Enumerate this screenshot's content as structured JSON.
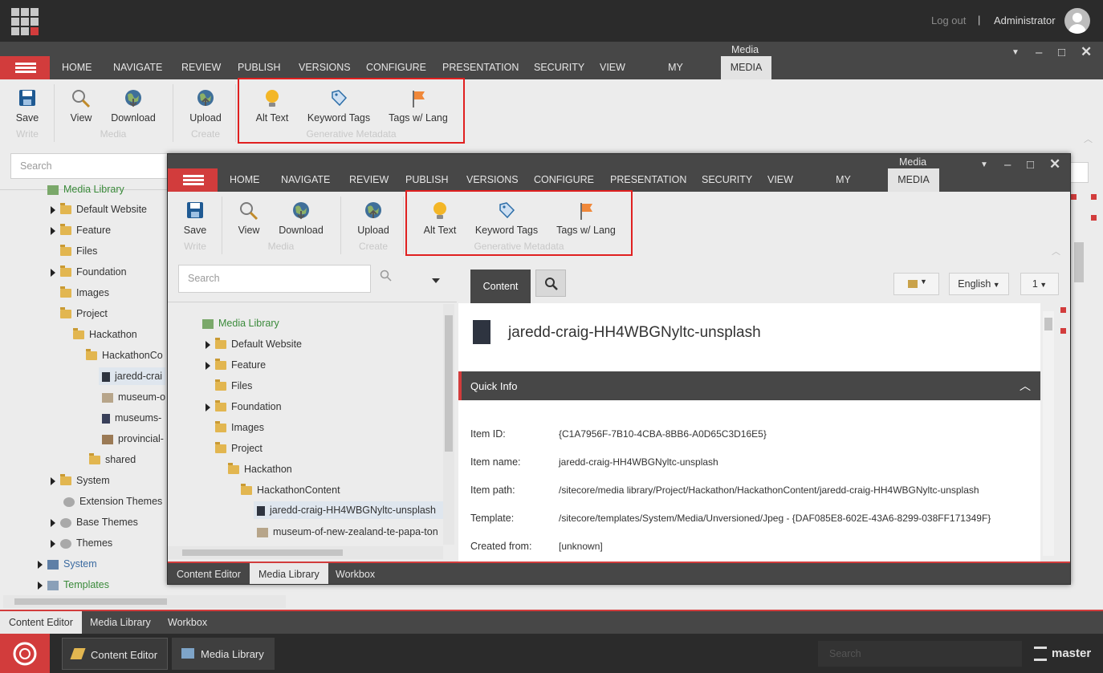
{
  "topbar": {
    "logout": "Log out",
    "separator": "|",
    "user": "Administrator"
  },
  "outer": {
    "title": "Media",
    "tabs": [
      "HOME",
      "NAVIGATE",
      "REVIEW",
      "PUBLISH",
      "VERSIONS",
      "CONFIGURE",
      "PRESENTATION",
      "SECURITY",
      "VIEW",
      "MY TOOLBAR",
      "MEDIA"
    ],
    "ribbon": {
      "save": "Save",
      "view": "View",
      "download": "Download",
      "upload": "Upload",
      "alt_text": "Alt Text",
      "keyword_tags": "Keyword Tags",
      "tags_lang": "Tags w/ Lang",
      "grp_write": "Write",
      "grp_media": "Media",
      "grp_create": "Create",
      "grp_gen": "Generative Metadata"
    },
    "search_placeholder": "Search",
    "tree": [
      "Media Library",
      "Default Website",
      "Feature",
      "Files",
      "Foundation",
      "Images",
      "Project",
      "Hackathon",
      "HackathonCo",
      "jaredd-crai",
      "museum-o",
      "museums-",
      "provincial-",
      "shared",
      "System",
      "Extension Themes",
      "Base Themes",
      "Themes",
      "System",
      "Templates"
    ],
    "bottom_tabs": [
      "Content Editor",
      "Media Library",
      "Workbox"
    ]
  },
  "inner": {
    "title": "Media",
    "tabs": [
      "HOME",
      "NAVIGATE",
      "REVIEW",
      "PUBLISH",
      "VERSIONS",
      "CONFIGURE",
      "PRESENTATION",
      "SECURITY",
      "VIEW",
      "MY TOOLBAR",
      "MEDIA"
    ],
    "ribbon": {
      "save": "Save",
      "view": "View",
      "download": "Download",
      "upload": "Upload",
      "alt_text": "Alt Text",
      "keyword_tags": "Keyword Tags",
      "tags_lang": "Tags w/ Lang",
      "grp_write": "Write",
      "grp_media": "Media",
      "grp_create": "Create",
      "grp_gen": "Generative Metadata"
    },
    "search_placeholder": "Search",
    "tree": [
      "Media Library",
      "Default Website",
      "Feature",
      "Files",
      "Foundation",
      "Images",
      "Project",
      "Hackathon",
      "HackathonContent",
      "jaredd-craig-HH4WBGNyltc-unsplash",
      "museum-of-new-zealand-te-papa-ton"
    ],
    "content_tab": "Content",
    "lang": "English",
    "version": "1",
    "item_title": "jaredd-craig-HH4WBGNyltc-unsplash",
    "quick_info": "Quick Info",
    "fields": [
      {
        "label": "Item ID:",
        "value": "{C1A7956F-7B10-4CBA-8BB6-A0D65C3D16E5}"
      },
      {
        "label": "Item name:",
        "value": "jaredd-craig-HH4WBGNyltc-unsplash"
      },
      {
        "label": "Item path:",
        "value": "/sitecore/media library/Project/Hackathon/HackathonContent/jaredd-craig-HH4WBGNyltc-unsplash"
      },
      {
        "label": "Template:",
        "value": "/sitecore/templates/System/Media/Unversioned/Jpeg - {DAF085E8-602E-43A6-8299-038FF171349F}"
      },
      {
        "label": "Created from:",
        "value": "[unknown]"
      }
    ],
    "bottom_tabs": [
      "Content Editor",
      "Media Library",
      "Workbox"
    ]
  },
  "taskbar": {
    "content_editor": "Content Editor",
    "media_library": "Media Library",
    "database": "master",
    "search_placeholder": "Search"
  }
}
